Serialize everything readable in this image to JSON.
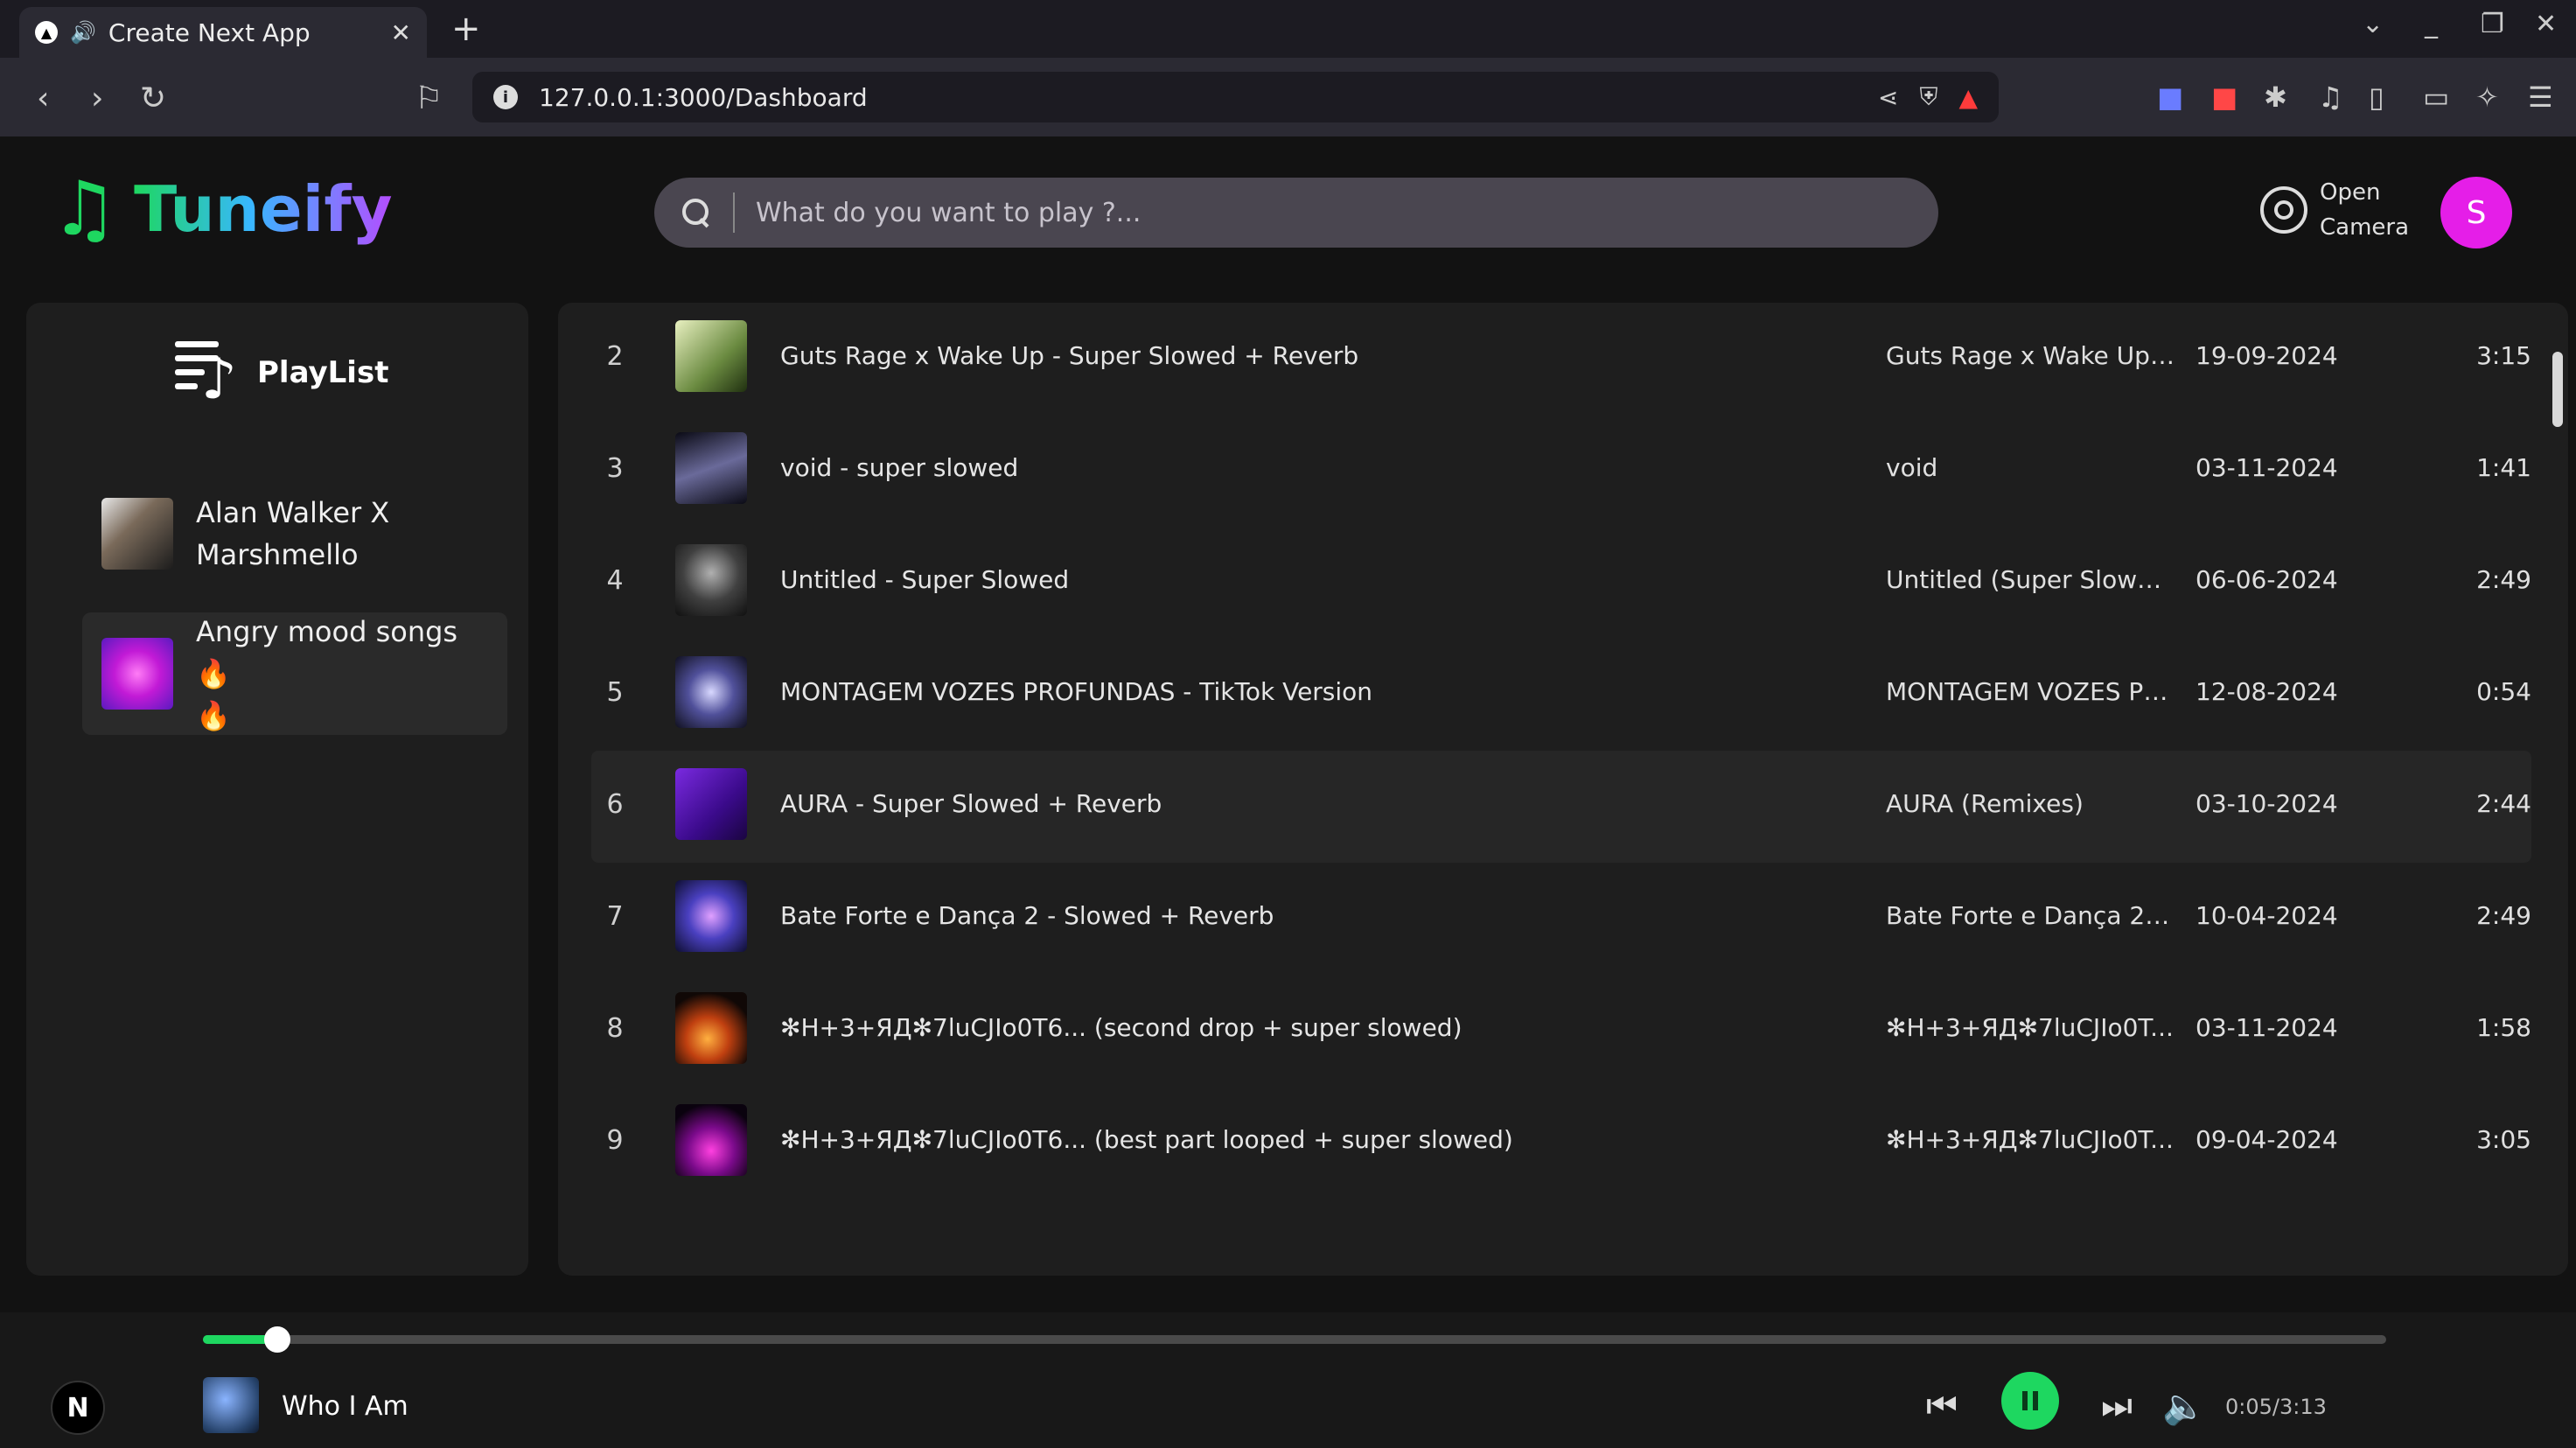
{
  "browser": {
    "tab_title": "Create Next App",
    "new_tab": "+",
    "url": "127.0.0.1:3000/Dashboard"
  },
  "app": {
    "brand": "Tuneify",
    "search_placeholder": "What do you want to play ?...",
    "camera_label_1": "Open",
    "camera_label_2": "Camera",
    "avatar_letter": "S",
    "accent_color": "#1ed760",
    "avatar_color": "#e51ee8"
  },
  "sidebar": {
    "heading": "PlayList",
    "items": [
      {
        "line1": "Alan Walker X",
        "line2": "Marshmello"
      },
      {
        "line1": "Angry mood songs🔥",
        "line2": "🔥"
      }
    ]
  },
  "songs": [
    {
      "num": "2",
      "title": "Guts Rage x Wake Up - Super Slowed + Reverb",
      "album": "Guts Rage x Wake Up (...",
      "date": "19-09-2024",
      "duration": "3:15"
    },
    {
      "num": "3",
      "title": "void - super slowed",
      "album": "void",
      "date": "03-11-2024",
      "duration": "1:41"
    },
    {
      "num": "4",
      "title": "Untitled - Super Slowed",
      "album": "Untitled (Super Slowed)",
      "date": "06-06-2024",
      "duration": "2:49"
    },
    {
      "num": "5",
      "title": "MONTAGEM VOZES PROFUNDAS - TikTok Version",
      "album": "MONTAGEM VOZES PR...",
      "date": "12-08-2024",
      "duration": "0:54"
    },
    {
      "num": "6",
      "title": "AURA - Super Slowed + Reverb",
      "album": "AURA (Remixes)",
      "date": "03-10-2024",
      "duration": "2:44"
    },
    {
      "num": "7",
      "title": "Bate Forte e Dança 2 - Slowed + Reverb",
      "album": "Bate Forte e Dança 2 (S...",
      "date": "10-04-2024",
      "duration": "2:49"
    },
    {
      "num": "8",
      "title": "✻H+3+ЯД✻7luCJIo0T6... (second drop + super slowed)",
      "album": "✻H+3+ЯД✻7luCJIo0T...",
      "date": "03-11-2024",
      "duration": "1:58"
    },
    {
      "num": "9",
      "title": "✻H+3+ЯД✻7luCJIo0T6... (best part looped + super slowed)",
      "album": "✻H+3+ЯД✻7luCJIo0T...",
      "date": "09-04-2024",
      "duration": "3:05"
    }
  ],
  "player": {
    "now_playing": "Who I Am",
    "time": "0:05/3:13",
    "progress": 0.034,
    "badge": "N"
  }
}
